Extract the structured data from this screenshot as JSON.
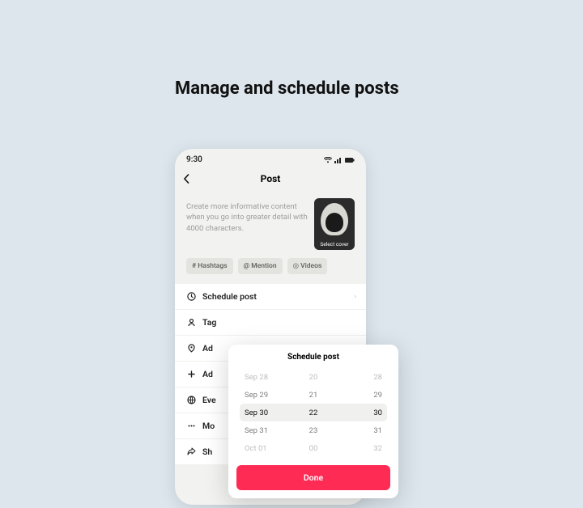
{
  "heading": "Manage and schedule posts",
  "status": {
    "time": "9:30"
  },
  "header": {
    "title": "Post"
  },
  "composer": {
    "placeholder": "Create more informative content when you go into greater detail with 4000 characters.",
    "thumb_caption": "Select cover"
  },
  "chips": {
    "hashtags": "# Hashtags",
    "mention": "@ Mention",
    "videos": "◎ Videos"
  },
  "options": {
    "schedule": "Schedule post",
    "tag": "Tag",
    "add_loc": "Ad",
    "add": "Ad",
    "everyone": "Eve",
    "more": "Mo",
    "share": "Sh"
  },
  "popup": {
    "title": "Schedule post",
    "rows": [
      {
        "d": "Sep 28",
        "h": "20",
        "m": "28"
      },
      {
        "d": "Sep 29",
        "h": "21",
        "m": "29"
      },
      {
        "d": "Sep 30",
        "h": "22",
        "m": "30"
      },
      {
        "d": "Sep 31",
        "h": "23",
        "m": "31"
      },
      {
        "d": "Oct 01",
        "h": "00",
        "m": "32"
      }
    ],
    "done": "Done"
  }
}
